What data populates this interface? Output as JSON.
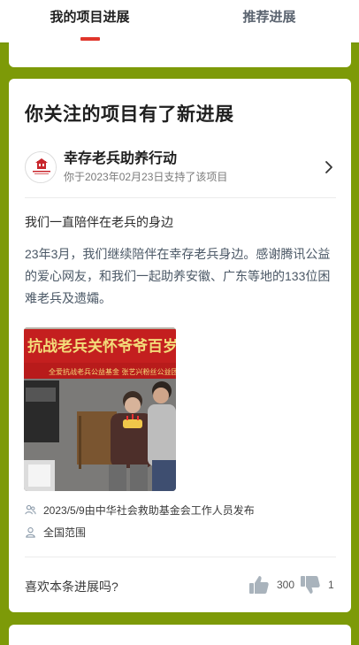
{
  "tabs": [
    {
      "label": "我的项目进展",
      "active": true
    },
    {
      "label": "推荐进展",
      "active": false
    }
  ],
  "card": {
    "title": "你关注的项目有了新进展",
    "project": {
      "name": "幸存老兵助养行动",
      "subtitle": "你于2023年02月23日支持了该项目"
    },
    "headline": "我们一直陪伴在老兵的身边",
    "body": "23年3月，我们继续陪伴在幸存老兵身边。感谢腾讯公益的爱心网友，和我们一起助养安徽、广东等地的133位困难老兵及遗孀。",
    "meta": {
      "publisher": "2023/5/9由中华社会救助基金会工作人员发布",
      "scope": "全国范围"
    },
    "footer": {
      "question": "喜欢本条进展吗?",
      "likes": "300",
      "dislikes": "1"
    }
  },
  "colors": {
    "background": "#7d9a08",
    "accent": "#e0352b",
    "banner_red": "#c41f1f"
  },
  "icons": {
    "avatar": "project-logo-icon",
    "chevron": "chevron-right-icon",
    "publisher": "people-icon",
    "scope": "location-person-icon",
    "like": "thumbs-up-icon",
    "dislike": "thumbs-down-icon"
  }
}
